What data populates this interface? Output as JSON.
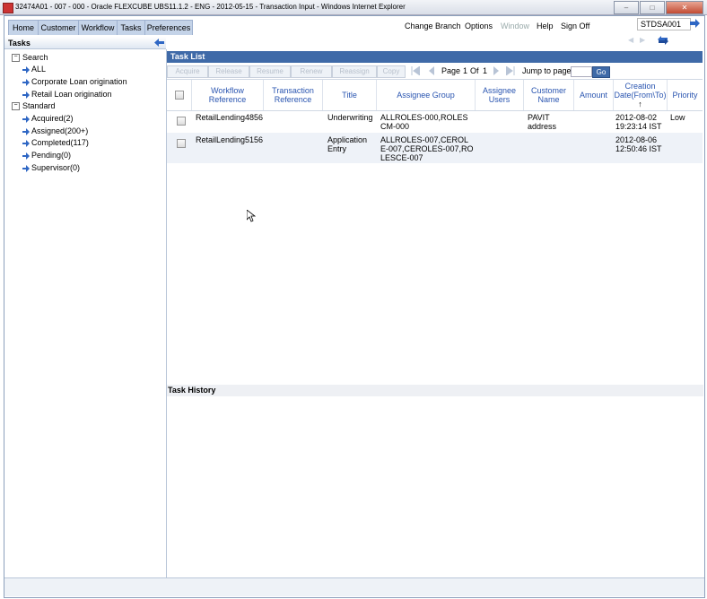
{
  "window": {
    "title": "32474A01 - 007 - 000 - Oracle FLEXCUBE UBS11.1.2 - ENG - 2012-05-15 - Transaction Input - Windows Internet Explorer"
  },
  "menu": {
    "tabs": [
      "Home",
      "Customer",
      "Workflow",
      "Tasks",
      "Preferences"
    ],
    "right_items": [
      "Change Branch",
      "Options",
      "Window",
      "Help",
      "Sign Off"
    ],
    "user_id": "STDSA001"
  },
  "tasks_panel": {
    "title": "Tasks",
    "search_label": "Search",
    "search_items": [
      "ALL",
      "Corporate Loan origination",
      "Retail Loan origination"
    ],
    "standard_label": "Standard",
    "standard_items": [
      "Acquired(2)",
      "Assigned(200+)",
      "Completed(117)",
      "Pending(0)",
      "Supervisor(0)"
    ]
  },
  "task_list": {
    "title": "Task List",
    "toolbar_buttons": [
      "Acquire",
      "Release",
      "Resume",
      "Renew",
      "Reassign",
      "Copy"
    ],
    "pager": {
      "page_label": "Page",
      "current": "1",
      "of_label": "Of",
      "total": "1",
      "jump_label": "Jump to page",
      "go_label": "Go"
    },
    "columns": [
      "Workflow Reference",
      "Transaction Reference",
      "Title",
      "Assignee Group",
      "Assignee Users",
      "Customer Name",
      "Amount",
      "Creation Date(From\\To)",
      "Priority"
    ],
    "sort_indicator": "↑",
    "rows": [
      {
        "workflow_ref": "RetailLending4856",
        "txn_ref": "",
        "title": "Underwriting",
        "assignee_group": "ALLROLES-000,ROLESCM-000",
        "assignee_users": "",
        "customer_name": "PAVIT address",
        "amount": "",
        "creation_date": "2012-08-02 19:23:14 IST",
        "priority": "Low"
      },
      {
        "workflow_ref": "RetailLending5156",
        "txn_ref": "",
        "title": "Application Entry",
        "assignee_group": "ALLROLES-007,CEROLE-007,CEROLES-007,ROLESCE-007",
        "assignee_users": "",
        "customer_name": "",
        "amount": "",
        "creation_date": "2012-08-06 12:50:46 IST",
        "priority": ""
      }
    ]
  },
  "task_history": {
    "title": "Task History"
  },
  "colors": {
    "accent": "#3f6aa8",
    "header_text": "#2a55b0",
    "menu_tab": "#c4d3e8"
  }
}
